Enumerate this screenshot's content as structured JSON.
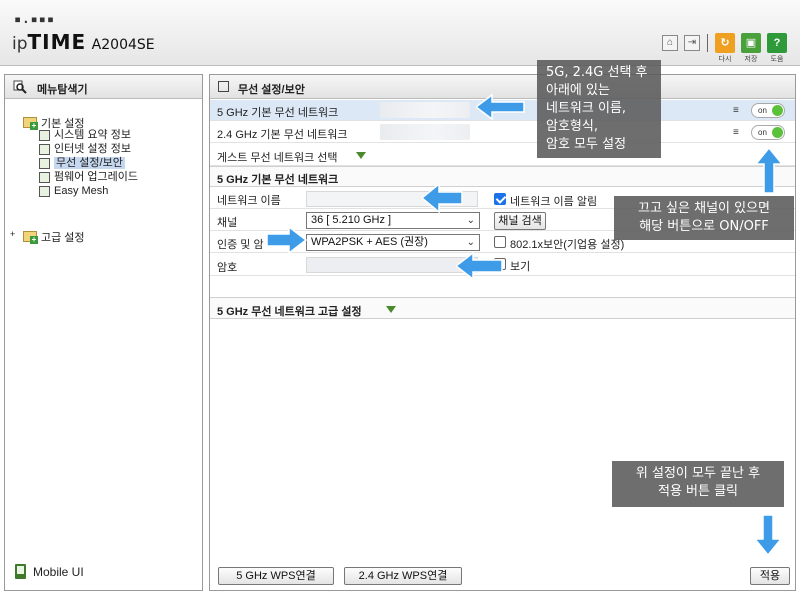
{
  "header": {
    "logo_dots": "▪.▪▪▪",
    "logo_ip": "ip",
    "logo_time": "TIME",
    "model": "A2004SE",
    "buttons": [
      {
        "name": "home-icon",
        "glyph": "⌂"
      },
      {
        "name": "logout-icon",
        "glyph": "⇥"
      },
      {
        "name": "refresh-button",
        "label": "다시",
        "color": "#f0a020"
      },
      {
        "name": "save-button",
        "label": "저장",
        "color": "#4aa03a"
      },
      {
        "name": "help-button",
        "label": "도움",
        "color": "#2f9a3a"
      }
    ]
  },
  "sidebar": {
    "title": "메뉴탐색기",
    "basic_label": "기본 설정",
    "items": [
      {
        "label": "시스템 요약 정보"
      },
      {
        "label": "인터넷 설정 정보"
      },
      {
        "label": "무선 설정/보안",
        "selected": true
      },
      {
        "label": "펌웨어 업그레이드"
      },
      {
        "label": "Easy Mesh"
      }
    ],
    "advanced_label": "고급 설정",
    "mobile_ui": "Mobile UI"
  },
  "main": {
    "title": "무선 설정/보안",
    "networks": [
      {
        "label": "5 GHz 기본 무선 네트워크",
        "toggle": "on"
      },
      {
        "label": "2.4 GHz 기본 무선 네트워크",
        "toggle": "on"
      }
    ],
    "guest_label": "게스트 무선 네트워크 선택",
    "basic_section": "5 GHz 기본 무선 네트워크",
    "fields": {
      "ssid_label": "네트워크 이름",
      "channel_label": "채널",
      "auth_label": "인증 및 암",
      "password_label": "암호",
      "channel_value": "36 [ 5.210 GHz ]",
      "auth_value": "WPA2PSK + AES (권장)"
    },
    "options": {
      "ssid_broadcast": "네트워크 이름 알림",
      "channel_search": "채널 검색",
      "dot1x": "802.1x보안(기업용 설정)",
      "show_password": "보기"
    },
    "advanced_section": "5 GHz 무선 네트워크 고급 설정",
    "wps5": "5 GHz WPS연결",
    "wps24": "2.4 GHz WPS연결",
    "apply": "적용"
  },
  "annotations": {
    "note1": [
      "5G, 2.4G 선택 후",
      "아래에 있는",
      "네트워크 이름,",
      "암호형식,",
      "암호 모두 설정"
    ],
    "note2": [
      "끄고 싶은 채널이 있으면",
      "해당 버튼으로 ON/OFF"
    ],
    "note3": [
      "위 설정이 모두 끝난 후",
      "적용 버튼 클릭"
    ]
  },
  "colors": {
    "accent_blue": "#3d9be8",
    "toggle_green": "#5cc13a",
    "selected_row": "#dde8f6"
  }
}
